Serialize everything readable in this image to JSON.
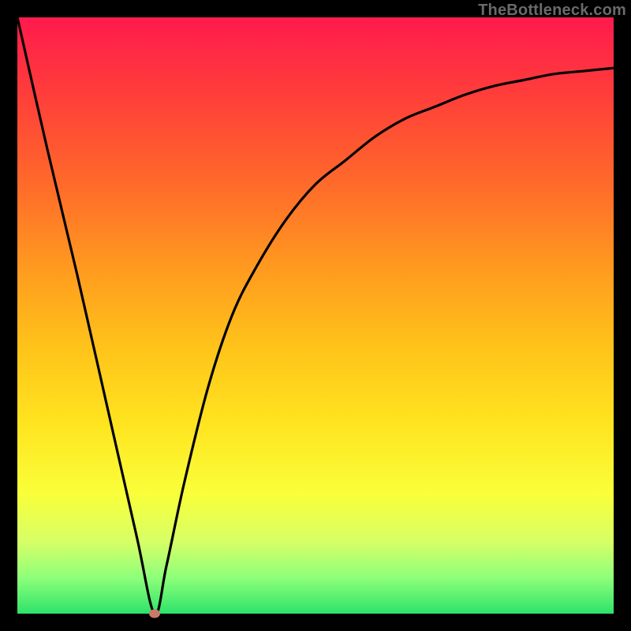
{
  "watermark": "TheBottleneck.com",
  "chart_data": {
    "type": "line",
    "title": "",
    "xlabel": "",
    "ylabel": "",
    "xlim": [
      0,
      100
    ],
    "ylim": [
      0,
      100
    ],
    "grid": false,
    "series": [
      {
        "name": "bottleneck-curve",
        "x": [
          0,
          5,
          10,
          15,
          20,
          23,
          25,
          28,
          32,
          36,
          40,
          45,
          50,
          55,
          60,
          65,
          70,
          75,
          80,
          85,
          90,
          95,
          100
        ],
        "values": [
          100,
          78,
          57,
          35,
          13,
          0,
          8,
          22,
          38,
          50,
          58,
          66,
          72,
          76,
          80,
          83,
          85,
          87,
          88.5,
          89.5,
          90.5,
          91,
          91.5
        ]
      }
    ],
    "minimum_marker": {
      "x": 23,
      "y": 0
    },
    "marker_color": "#cb7a6a",
    "gradient_stops": [
      {
        "pos": 0,
        "color": "#ff1a4d"
      },
      {
        "pos": 12,
        "color": "#ff3b3b"
      },
      {
        "pos": 28,
        "color": "#ff6a2a"
      },
      {
        "pos": 42,
        "color": "#ff9a1f"
      },
      {
        "pos": 55,
        "color": "#ffc21a"
      },
      {
        "pos": 68,
        "color": "#ffe41f"
      },
      {
        "pos": 80,
        "color": "#f9ff3a"
      },
      {
        "pos": 88,
        "color": "#d6ff66"
      },
      {
        "pos": 94,
        "color": "#8dff7a"
      },
      {
        "pos": 100,
        "color": "#2de36a"
      }
    ]
  }
}
